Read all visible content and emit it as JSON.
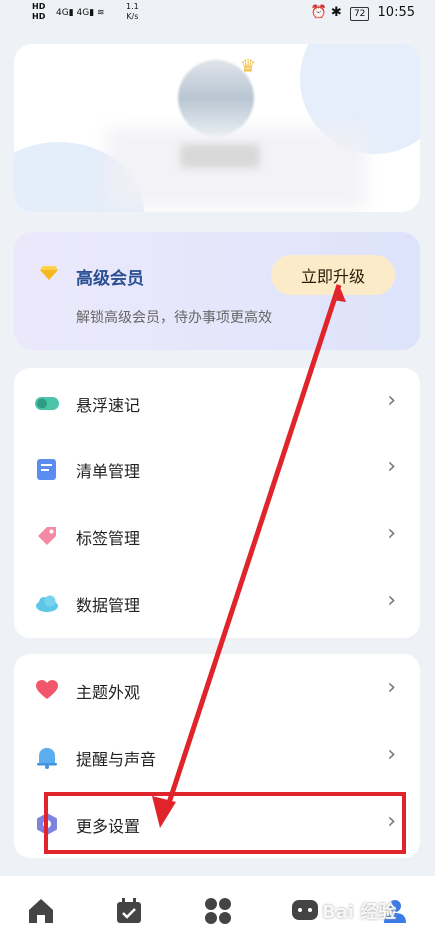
{
  "status": {
    "left_top": "HD",
    "left_bottom": "HD",
    "network": "4G",
    "speed_value": "1.1",
    "speed_unit": "K/s",
    "battery": "72",
    "time": "10:55"
  },
  "vip": {
    "title": "高级会员",
    "subtitle": "解锁高级会员，待办事项更高效",
    "upgrade_label": "立即升级"
  },
  "list1": [
    {
      "label": "悬浮速记"
    },
    {
      "label": "清单管理"
    },
    {
      "label": "标签管理"
    },
    {
      "label": "数据管理"
    }
  ],
  "list2": [
    {
      "label": "主题外观"
    },
    {
      "label": "提醒与声音"
    },
    {
      "label": "更多设置"
    }
  ],
  "chevron": "›",
  "colors": {
    "accent_red": "#e0242c",
    "vip_title": "#2a4f93",
    "upgrade_bg": "#fcebc8"
  },
  "watermark": "Bai 经验"
}
